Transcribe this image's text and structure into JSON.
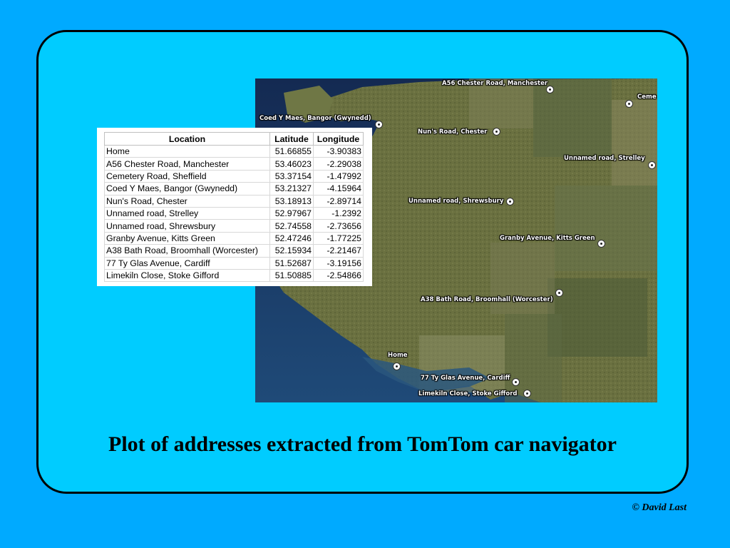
{
  "slide": {
    "caption": "Plot of addresses extracted from TomTom car navigator",
    "copyright": "© David Last",
    "colors": {
      "background": "#00aaff",
      "panel": "#00ccff",
      "border": "#000000"
    }
  },
  "table": {
    "headers": [
      "Location",
      "Latitude",
      "Longitude"
    ],
    "rows": [
      {
        "location": "Home",
        "latitude": "51.66855",
        "longitude": "-3.90383"
      },
      {
        "location": "A56 Chester Road, Manchester",
        "latitude": "53.46023",
        "longitude": "-2.29038"
      },
      {
        "location": "Cemetery Road, Sheffield",
        "latitude": "53.37154",
        "longitude": "-1.47992"
      },
      {
        "location": "Coed Y Maes, Bangor (Gwynedd)",
        "latitude": "53.21327",
        "longitude": "-4.15964"
      },
      {
        "location": "Nun's Road, Chester",
        "latitude": "53.18913",
        "longitude": "-2.89714"
      },
      {
        "location": "Unnamed road, Strelley",
        "latitude": "52.97967",
        "longitude": "-1.2392"
      },
      {
        "location": "Unnamed road, Shrewsbury",
        "latitude": "52.74558",
        "longitude": "-2.73656"
      },
      {
        "location": "Granby Avenue, Kitts Green",
        "latitude": "52.47246",
        "longitude": "-1.77225"
      },
      {
        "location": "A38 Bath Road, Broomhall (Worcester)",
        "latitude": "52.15934",
        "longitude": "-2.21467"
      },
      {
        "location": "77 Ty Glas Avenue, Cardiff",
        "latitude": "51.52687",
        "longitude": "-3.19156"
      },
      {
        "location": "Limekiln Close, Stoke Gifford",
        "latitude": "51.50885",
        "longitude": "-2.54866"
      }
    ]
  },
  "map": {
    "markers": [
      {
        "label": "A56 Chester Road, Manchester"
      },
      {
        "label": "Ceme"
      },
      {
        "label": "Coed Y Maes, Bangor (Gwynedd)"
      },
      {
        "label": "Nun's Road, Chester"
      },
      {
        "label": "Unnamed road, Strelley"
      },
      {
        "label": "Unnamed road, Shrewsbury"
      },
      {
        "label": "Granby Avenue, Kitts Green"
      },
      {
        "label": "A38 Bath Road, Broomhall (Worcester)"
      },
      {
        "label": "Home"
      },
      {
        "label": "77 Ty Glas Avenue, Cardiff"
      },
      {
        "label": "Limekiln Close, Stoke Gifford"
      }
    ]
  }
}
